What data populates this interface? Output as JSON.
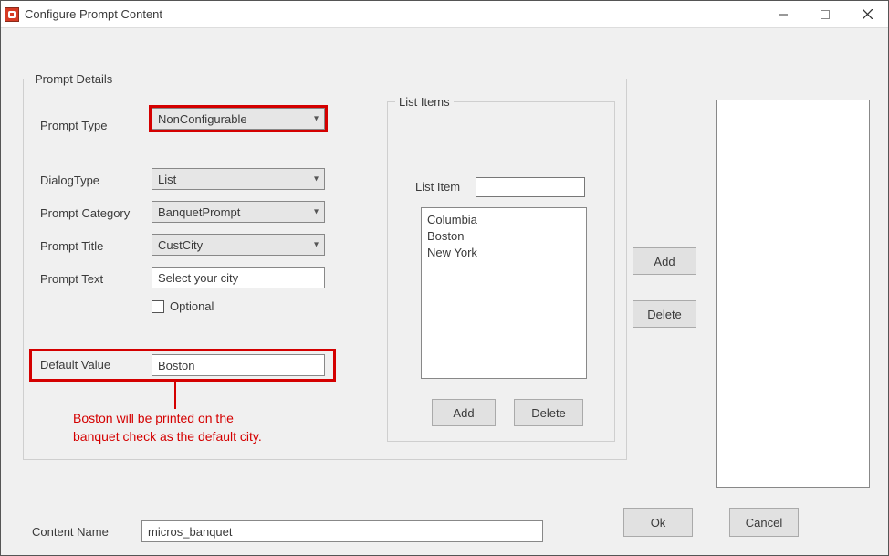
{
  "window": {
    "title": "Configure Prompt Content"
  },
  "prompt_details": {
    "legend": "Prompt Details",
    "labels": {
      "prompt_type": "Prompt Type",
      "dialog_type": "DialogType",
      "prompt_category": "Prompt Category",
      "prompt_title": "Prompt Title",
      "prompt_text": "Prompt Text",
      "optional": "Optional",
      "default_value": "Default Value"
    },
    "values": {
      "prompt_type": "NonConfigurable",
      "dialog_type": "List",
      "prompt_category": "BanquetPrompt",
      "prompt_title": "CustCity",
      "prompt_text": "Select your city",
      "default_value": "Boston"
    }
  },
  "list_items": {
    "legend": "List Items",
    "label": "List Item",
    "input": "",
    "items": [
      "Columbia",
      "Boston",
      "New York"
    ],
    "add": "Add",
    "delete": "Delete"
  },
  "side": {
    "add": "Add",
    "delete": "Delete"
  },
  "content_name": {
    "label": "Content Name",
    "value": "micros_banquet"
  },
  "buttons": {
    "ok": "Ok",
    "cancel": "Cancel"
  },
  "annotation": {
    "line1": "Boston will be printed on the",
    "line2": "banquet check as the default city."
  }
}
